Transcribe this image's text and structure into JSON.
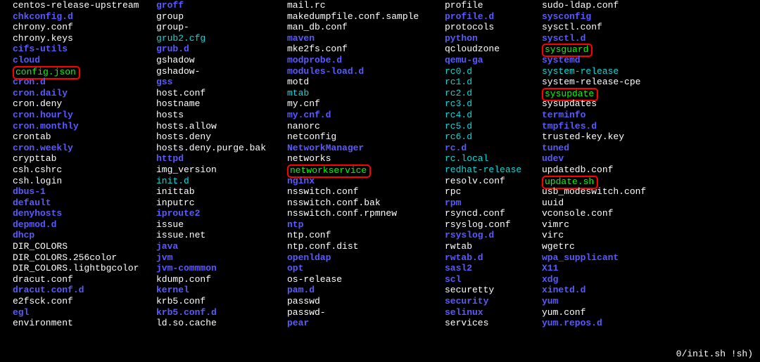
{
  "prompt": "0/init.sh !sh)",
  "columns": [
    [
      {
        "t": "centos-release-upstream",
        "c": "file"
      },
      {
        "t": "chkconfig.d",
        "c": "dir"
      },
      {
        "t": "chrony.conf",
        "c": "file"
      },
      {
        "t": "chrony.keys",
        "c": "file"
      },
      {
        "t": "cifs-utils",
        "c": "dir"
      },
      {
        "t": "cloud",
        "c": "dir"
      },
      {
        "t": "config.json",
        "c": "exec",
        "hl": true
      },
      {
        "t": "cron.d",
        "c": "dir"
      },
      {
        "t": "cron.daily",
        "c": "dir"
      },
      {
        "t": "cron.deny",
        "c": "file"
      },
      {
        "t": "cron.hourly",
        "c": "dir"
      },
      {
        "t": "cron.monthly",
        "c": "dir"
      },
      {
        "t": "crontab",
        "c": "file"
      },
      {
        "t": "cron.weekly",
        "c": "dir"
      },
      {
        "t": "crypttab",
        "c": "file"
      },
      {
        "t": "csh.cshrc",
        "c": "file"
      },
      {
        "t": "csh.login",
        "c": "file"
      },
      {
        "t": "dbus-1",
        "c": "dir"
      },
      {
        "t": "default",
        "c": "dir"
      },
      {
        "t": "denyhosts",
        "c": "dir"
      },
      {
        "t": "depmod.d",
        "c": "dir"
      },
      {
        "t": "dhcp",
        "c": "dir"
      },
      {
        "t": "DIR_COLORS",
        "c": "file"
      },
      {
        "t": "DIR_COLORS.256color",
        "c": "file"
      },
      {
        "t": "DIR_COLORS.lightbgcolor",
        "c": "file"
      },
      {
        "t": "dracut.conf",
        "c": "file"
      },
      {
        "t": "dracut.conf.d",
        "c": "dir"
      },
      {
        "t": "e2fsck.conf",
        "c": "file"
      },
      {
        "t": "egl",
        "c": "dir"
      },
      {
        "t": "environment",
        "c": "file"
      }
    ],
    [
      {
        "t": "groff",
        "c": "dir"
      },
      {
        "t": "group",
        "c": "file"
      },
      {
        "t": "group-",
        "c": "file"
      },
      {
        "t": "grub2.cfg",
        "c": "link"
      },
      {
        "t": "grub.d",
        "c": "dir"
      },
      {
        "t": "gshadow",
        "c": "file"
      },
      {
        "t": "gshadow-",
        "c": "file"
      },
      {
        "t": "gss",
        "c": "dir"
      },
      {
        "t": "host.conf",
        "c": "file"
      },
      {
        "t": "hostname",
        "c": "file"
      },
      {
        "t": "hosts",
        "c": "file"
      },
      {
        "t": "hosts.allow",
        "c": "file"
      },
      {
        "t": "hosts.deny",
        "c": "file"
      },
      {
        "t": "hosts.deny.purge.bak",
        "c": "file"
      },
      {
        "t": "httpd",
        "c": "dir"
      },
      {
        "t": "img_version",
        "c": "file"
      },
      {
        "t": "init.d",
        "c": "link"
      },
      {
        "t": "inittab",
        "c": "file"
      },
      {
        "t": "inputrc",
        "c": "file"
      },
      {
        "t": "iproute2",
        "c": "dir"
      },
      {
        "t": "issue",
        "c": "file"
      },
      {
        "t": "issue.net",
        "c": "file"
      },
      {
        "t": "java",
        "c": "dir"
      },
      {
        "t": "jvm",
        "c": "dir"
      },
      {
        "t": "jvm-commmon",
        "c": "dir"
      },
      {
        "t": "kdump.conf",
        "c": "file"
      },
      {
        "t": "kernel",
        "c": "dir"
      },
      {
        "t": "krb5.conf",
        "c": "file"
      },
      {
        "t": "krb5.conf.d",
        "c": "dir"
      },
      {
        "t": "ld.so.cache",
        "c": "file"
      }
    ],
    [
      {
        "t": "mail.rc",
        "c": "file"
      },
      {
        "t": "makedumpfile.conf.sample",
        "c": "file"
      },
      {
        "t": "man_db.conf",
        "c": "file"
      },
      {
        "t": "maven",
        "c": "dir"
      },
      {
        "t": "mke2fs.conf",
        "c": "file"
      },
      {
        "t": "modprobe.d",
        "c": "dir"
      },
      {
        "t": "modules-load.d",
        "c": "dir"
      },
      {
        "t": "motd",
        "c": "file"
      },
      {
        "t": "mtab",
        "c": "link"
      },
      {
        "t": "my.cnf",
        "c": "file"
      },
      {
        "t": "my.cnf.d",
        "c": "dir"
      },
      {
        "t": "nanorc",
        "c": "file"
      },
      {
        "t": "netconfig",
        "c": "file"
      },
      {
        "t": "NetworkManager",
        "c": "dir"
      },
      {
        "t": "networks",
        "c": "file"
      },
      {
        "t": "networkservice",
        "c": "exec",
        "hl": true
      },
      {
        "t": "nginx",
        "c": "dir"
      },
      {
        "t": "nsswitch.conf",
        "c": "file"
      },
      {
        "t": "nsswitch.conf.bak",
        "c": "file"
      },
      {
        "t": "nsswitch.conf.rpmnew",
        "c": "file"
      },
      {
        "t": "ntp",
        "c": "dir"
      },
      {
        "t": "ntp.conf",
        "c": "file"
      },
      {
        "t": "ntp.conf.dist",
        "c": "file"
      },
      {
        "t": "openldap",
        "c": "dir"
      },
      {
        "t": "opt",
        "c": "dir"
      },
      {
        "t": "os-release",
        "c": "file"
      },
      {
        "t": "pam.d",
        "c": "dir"
      },
      {
        "t": "passwd",
        "c": "file"
      },
      {
        "t": "passwd-",
        "c": "file"
      },
      {
        "t": "pear",
        "c": "dir"
      }
    ],
    [
      {
        "t": "profile",
        "c": "file"
      },
      {
        "t": "profile.d",
        "c": "dir"
      },
      {
        "t": "protocols",
        "c": "file"
      },
      {
        "t": "python",
        "c": "dir"
      },
      {
        "t": "qcloudzone",
        "c": "file"
      },
      {
        "t": "qemu-ga",
        "c": "dir"
      },
      {
        "t": "rc0.d",
        "c": "link"
      },
      {
        "t": "rc1.d",
        "c": "link"
      },
      {
        "t": "rc2.d",
        "c": "link"
      },
      {
        "t": "rc3.d",
        "c": "link"
      },
      {
        "t": "rc4.d",
        "c": "link"
      },
      {
        "t": "rc5.d",
        "c": "link"
      },
      {
        "t": "rc6.d",
        "c": "link"
      },
      {
        "t": "rc.d",
        "c": "dir"
      },
      {
        "t": "rc.local",
        "c": "link"
      },
      {
        "t": "redhat-release",
        "c": "link"
      },
      {
        "t": "resolv.conf",
        "c": "file"
      },
      {
        "t": "rpc",
        "c": "file"
      },
      {
        "t": "rpm",
        "c": "dir"
      },
      {
        "t": "rsyncd.conf",
        "c": "file"
      },
      {
        "t": "rsyslog.conf",
        "c": "file"
      },
      {
        "t": "rsyslog.d",
        "c": "dir"
      },
      {
        "t": "rwtab",
        "c": "file"
      },
      {
        "t": "rwtab.d",
        "c": "dir"
      },
      {
        "t": "sasl2",
        "c": "dir"
      },
      {
        "t": "scl",
        "c": "dir"
      },
      {
        "t": "securetty",
        "c": "file"
      },
      {
        "t": "security",
        "c": "dir"
      },
      {
        "t": "selinux",
        "c": "dir"
      },
      {
        "t": "services",
        "c": "file"
      }
    ],
    [
      {
        "t": "sudo-ldap.conf",
        "c": "file"
      },
      {
        "t": "sysconfig",
        "c": "dir"
      },
      {
        "t": "sysctl.conf",
        "c": "file"
      },
      {
        "t": "sysctl.d",
        "c": "dir"
      },
      {
        "t": "sysguard",
        "c": "exec",
        "hl": true
      },
      {
        "t": "systemd",
        "c": "dir"
      },
      {
        "t": "system-release",
        "c": "link"
      },
      {
        "t": "system-release-cpe",
        "c": "file"
      },
      {
        "t": "sysupdate",
        "c": "exec",
        "hl": true
      },
      {
        "t": "sysupdates",
        "c": "file"
      },
      {
        "t": "terminfo",
        "c": "dir"
      },
      {
        "t": "tmpfiles.d",
        "c": "dir"
      },
      {
        "t": "trusted-key.key",
        "c": "file"
      },
      {
        "t": "tuned",
        "c": "dir"
      },
      {
        "t": "udev",
        "c": "dir"
      },
      {
        "t": "updatedb.conf",
        "c": "file"
      },
      {
        "t": "update.sh",
        "c": "exec",
        "hl": true
      },
      {
        "t": "usb_modeswitch.conf",
        "c": "file"
      },
      {
        "t": "uuid",
        "c": "file"
      },
      {
        "t": "vconsole.conf",
        "c": "file"
      },
      {
        "t": "vimrc",
        "c": "file"
      },
      {
        "t": "virc",
        "c": "file"
      },
      {
        "t": "wgetrc",
        "c": "file"
      },
      {
        "t": "wpa_supplicant",
        "c": "dir"
      },
      {
        "t": "X11",
        "c": "dir"
      },
      {
        "t": "xdg",
        "c": "dir"
      },
      {
        "t": "xinetd.d",
        "c": "dir"
      },
      {
        "t": "yum",
        "c": "dir"
      },
      {
        "t": "yum.conf",
        "c": "file"
      },
      {
        "t": "yum.repos.d",
        "c": "dir"
      }
    ]
  ]
}
